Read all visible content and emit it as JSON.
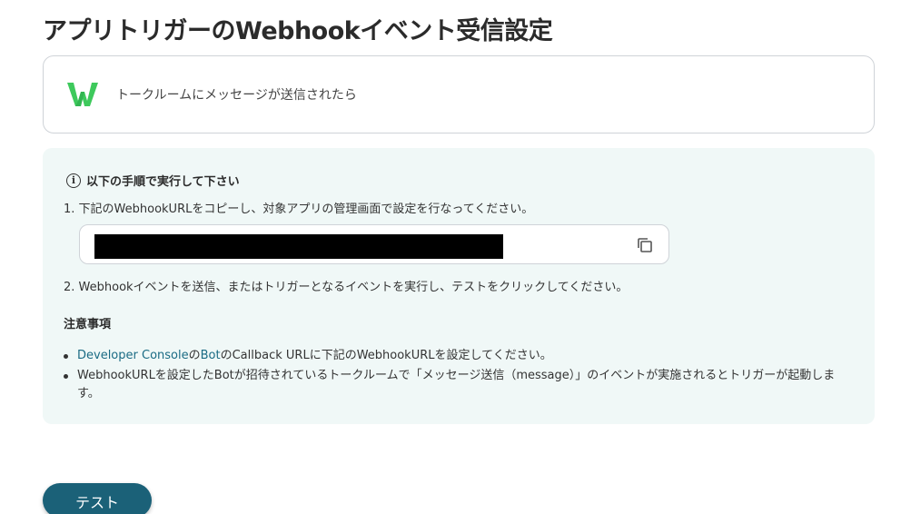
{
  "page": {
    "title": "アプリトリガーのWebhookイベント受信設定"
  },
  "trigger": {
    "app_icon": "lineworks-w-logo",
    "label": "トークルームにメッセージが送信されたら"
  },
  "instructions": {
    "heading_icon": "info-icon",
    "heading": "以下の手順で実行して下さい",
    "step1": "1. 下記のWebhookURLをコピーし、対象アプリの管理画面で設定を行なってください。",
    "webhook_url": "",
    "copy_icon": "copy-icon",
    "step2": "2. Webhookイベントを送信、またはトリガーとなるイベントを実行し、テストをクリックしてください。"
  },
  "notes": {
    "heading": "注意事項",
    "item1": {
      "link1": "Developer Console",
      "text1": "の",
      "link2": "Bot",
      "text2": "のCallback URLに下記のWebhookURLを設定してください。"
    },
    "item2": "WebhookURLを設定したBotが招待されているトークルームで「メッセージ送信（message）」のイベントが実施されるとトリガーが起動します。"
  },
  "actions": {
    "test_label": "テスト"
  },
  "colors": {
    "logo_green": "#3ec95c",
    "link": "#1a6b84",
    "panel_bg": "#f0f8f7",
    "button_bg": "#1b6178"
  }
}
